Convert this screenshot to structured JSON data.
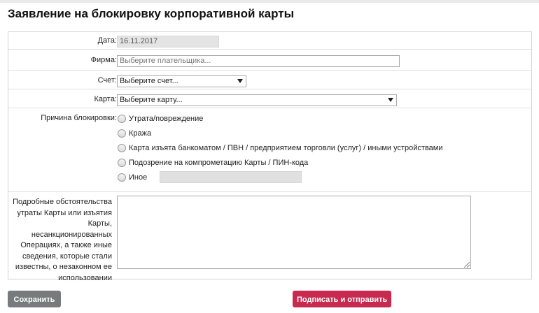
{
  "title": "Заявление на блокировку корпоративной карты",
  "fields": {
    "date_label": "Дата:",
    "date_value": "16.11.2017",
    "firm_label": "Фирма:",
    "firm_placeholder": "Выберите плательщика...",
    "account_label": "Счет:",
    "account_value": "Выберите счет...",
    "card_label": "Карта:",
    "card_value": "Выберите карту..."
  },
  "reason": {
    "label": "Причина блокировки:",
    "options": [
      "Утрата/повреждение",
      "Кража",
      "Карта изъята банкоматом / ПВН / предприятием торговли (услуг) / иными устройствами",
      "Подозрение на компрометацию Карты / ПИН-кода",
      "Иное"
    ]
  },
  "details": {
    "label": "Подробные обстоятельства утраты Карты или изъятия Карты, несанкционированных Операциях, а также иные сведения, которые стали известны, о незаконном ее использовании"
  },
  "buttons": {
    "save": "Сохранить",
    "sign_send": "Подписать и отправить"
  }
}
